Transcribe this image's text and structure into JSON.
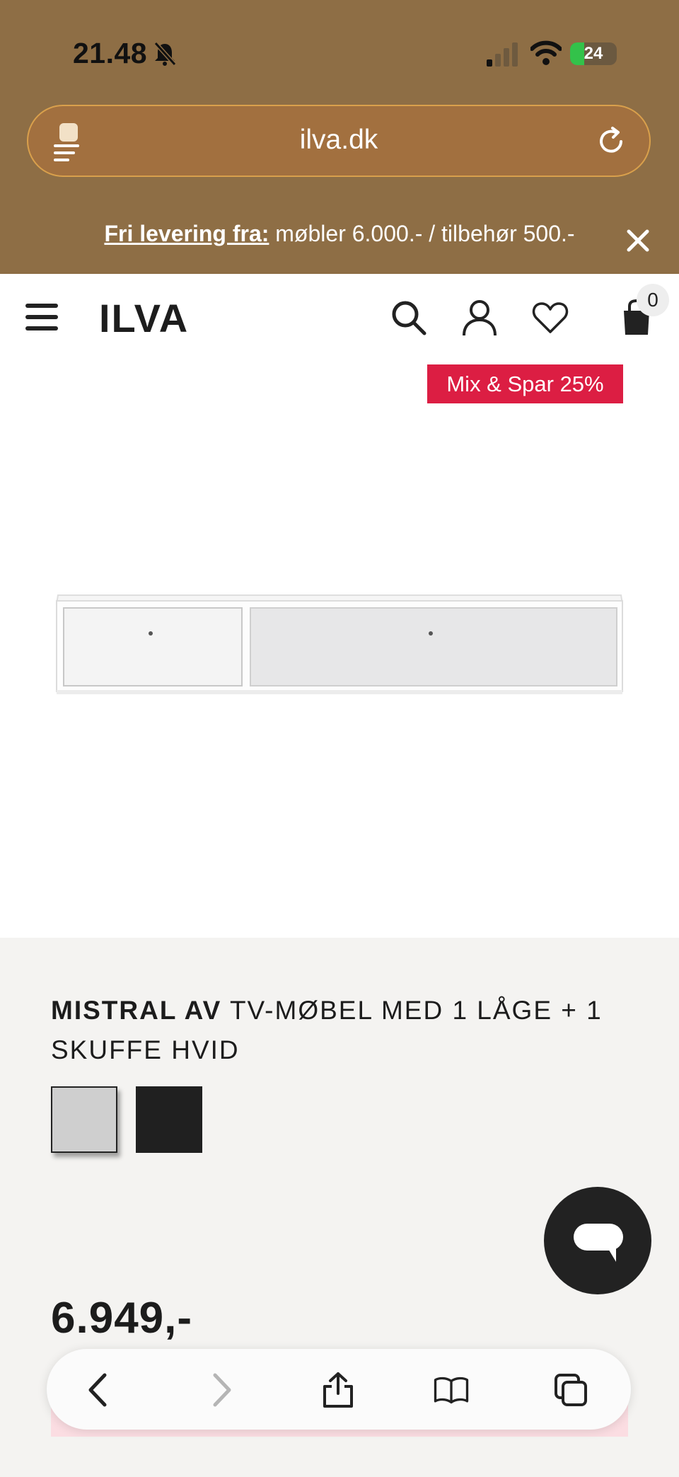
{
  "status_bar": {
    "time": "21.48",
    "battery": "24"
  },
  "browser": {
    "url": "ilva.dk"
  },
  "promo": {
    "label": "Fri levering fra:",
    "text": " møbler 6.000.- / tilbehør 500.-"
  },
  "header": {
    "logo": "ILVA",
    "cart_count": "0"
  },
  "product": {
    "badge": "Mix & Spar 25%",
    "brand": "MISTRAL AV",
    "name": " TV-MØBEL MED 1 LÅGE + 1 SKUFFE HVID",
    "swatches": [
      {
        "color": "#cfcfcf",
        "selected": true
      },
      {
        "color": "#202020",
        "selected": false
      }
    ],
    "price": "6.949,-"
  },
  "colors": {
    "brand_top": "#8e6e45",
    "badge": "#dc1e43"
  }
}
